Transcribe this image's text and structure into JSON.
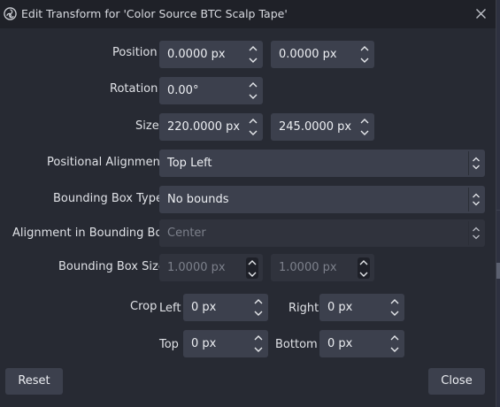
{
  "window": {
    "title": "Edit Transform for 'Color Source BTC Scalp Tape'"
  },
  "labels": {
    "position": "Position",
    "rotation": "Rotation",
    "size": "Size",
    "positional_alignment": "Positional Alignment",
    "bounding_box_type": "Bounding Box Type",
    "alignment_in_bounding_box": "Alignment in Bounding Box",
    "bounding_box_size": "Bounding Box Size",
    "crop": "Crop",
    "crop_left": "Left",
    "crop_right": "Right",
    "crop_top": "Top",
    "crop_bottom": "Bottom"
  },
  "fields": {
    "position_x": "0.0000 px",
    "position_y": "0.0000 px",
    "rotation": "0.00°",
    "size_width": "220.0000 px",
    "size_height": "245.0000 px",
    "positional_alignment": "Top Left",
    "bounding_box_type": "No bounds",
    "alignment_in_bounding_box": "Center",
    "bounding_box_width": "1.0000 px",
    "bounding_box_height": "1.0000 px",
    "crop_left": "0 px",
    "crop_right": "0 px",
    "crop_top": "0 px",
    "crop_bottom": "0 px"
  },
  "buttons": {
    "reset": "Reset",
    "close": "Close"
  },
  "icons": {
    "app": "obs-logo-icon",
    "close": "close-icon",
    "spin_up": "chevron-up-icon",
    "spin_down": "chevron-down-icon",
    "combo": "updown-chevron-icon"
  },
  "colors": {
    "window_bg": "#272a33",
    "titlebar_bg": "#1f2128",
    "field_bg": "#3c404d",
    "field_disabled_bg": "#30333d",
    "text": "#dfe1e6",
    "text_disabled": "#7c808b"
  }
}
